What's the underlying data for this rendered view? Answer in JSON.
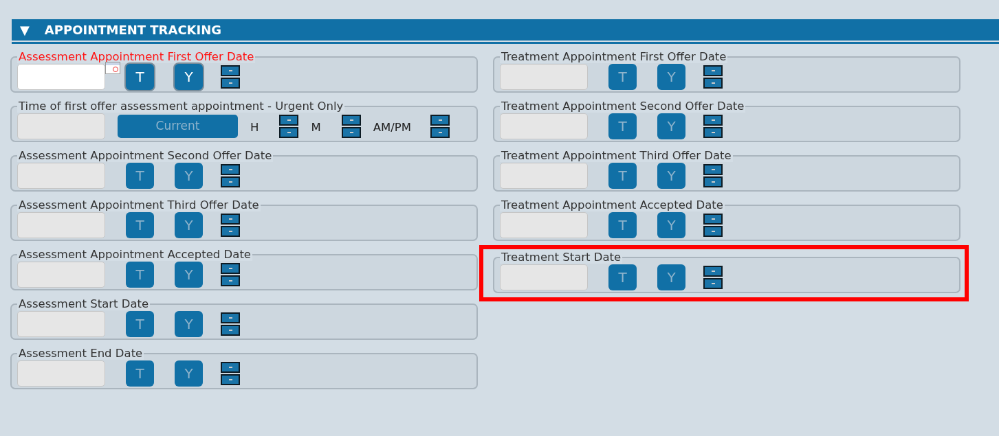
{
  "section": {
    "title": "APPOINTMENT TRACKING",
    "expanded": true,
    "toggle": "▼"
  },
  "left_fields": [
    {
      "kind": "date",
      "label": "Assessment Appointment First Offer Date",
      "required": true,
      "enabled": true,
      "highlighted": false,
      "buttons": [
        "T",
        "Y"
      ]
    },
    {
      "kind": "time",
      "label": "Time of first offer assessment appointment - Urgent Only",
      "required": false,
      "enabled": false,
      "highlighted": false,
      "button": "Current",
      "units": [
        "H",
        "M",
        "AM/PM"
      ]
    },
    {
      "kind": "date",
      "label": "Assessment Appointment Second Offer Date",
      "required": false,
      "enabled": false,
      "highlighted": false,
      "buttons": [
        "T",
        "Y"
      ]
    },
    {
      "kind": "date",
      "label": "Assessment Appointment Third Offer Date",
      "required": false,
      "enabled": false,
      "highlighted": false,
      "buttons": [
        "T",
        "Y"
      ]
    },
    {
      "kind": "date",
      "label": "Assessment Appointment Accepted Date",
      "required": false,
      "enabled": false,
      "highlighted": false,
      "buttons": [
        "T",
        "Y"
      ]
    },
    {
      "kind": "date",
      "label": "Assessment Start Date",
      "required": false,
      "enabled": false,
      "highlighted": false,
      "buttons": [
        "T",
        "Y"
      ]
    },
    {
      "kind": "date",
      "label": "Assessment End Date",
      "required": false,
      "enabled": false,
      "highlighted": false,
      "buttons": [
        "T",
        "Y"
      ]
    }
  ],
  "right_fields": [
    {
      "kind": "date",
      "label": "Treatment Appointment First Offer Date",
      "required": false,
      "enabled": false,
      "highlighted": false,
      "buttons": [
        "T",
        "Y"
      ]
    },
    {
      "kind": "date",
      "label": "Treatment Appointment Second Offer Date",
      "required": false,
      "enabled": false,
      "highlighted": false,
      "buttons": [
        "T",
        "Y"
      ]
    },
    {
      "kind": "date",
      "label": "Treatment Appointment Third Offer Date",
      "required": false,
      "enabled": false,
      "highlighted": false,
      "buttons": [
        "T",
        "Y"
      ]
    },
    {
      "kind": "date",
      "label": "Treatment Appointment Accepted Date",
      "required": false,
      "enabled": false,
      "highlighted": false,
      "buttons": [
        "T",
        "Y"
      ]
    },
    {
      "kind": "date",
      "label": "Treatment Start Date",
      "required": false,
      "enabled": false,
      "highlighted": true,
      "buttons": [
        "T",
        "Y"
      ]
    }
  ]
}
